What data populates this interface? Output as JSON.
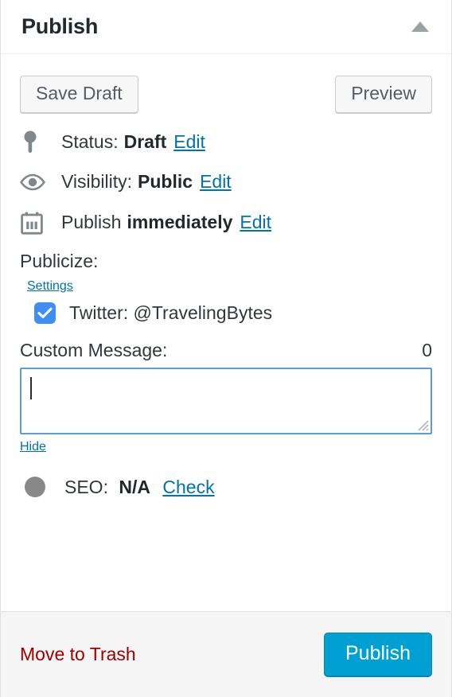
{
  "panel": {
    "title": "Publish",
    "toggle_icon": "caret-up-icon"
  },
  "minor_actions": {
    "save_draft_label": "Save Draft",
    "preview_label": "Preview"
  },
  "misc_rows": [
    {
      "icon": "pin-icon",
      "label": "Status:",
      "value": "Draft",
      "link": "Edit"
    },
    {
      "icon": "eye-icon",
      "label": "Visibility:",
      "value": "Public",
      "link": "Edit"
    },
    {
      "icon": "calendar-icon",
      "label": "Publish",
      "value": "immediately",
      "link": "Edit"
    }
  ],
  "publicize": {
    "label": "Publicize:",
    "settings_link": "Settings",
    "connection": {
      "checked": true,
      "label": "Twitter: @TravelingBytes"
    },
    "custom_message": {
      "label": "Custom Message:",
      "char_count": "0",
      "value": "",
      "placeholder": ""
    },
    "hide_link": "Hide"
  },
  "seo": {
    "indicator_color": "#888888",
    "label": "SEO:",
    "value": "N/A",
    "link": "Check"
  },
  "footer": {
    "trash_label": "Move to Trash",
    "publish_label": "Publish"
  },
  "colors": {
    "link": "#0073aa",
    "primary_button": "#00a0d2",
    "trash": "#a00000",
    "checkbox": "#3e8ef4",
    "focus_border": "#5b9dd9",
    "icon_gray": "#82878c"
  }
}
